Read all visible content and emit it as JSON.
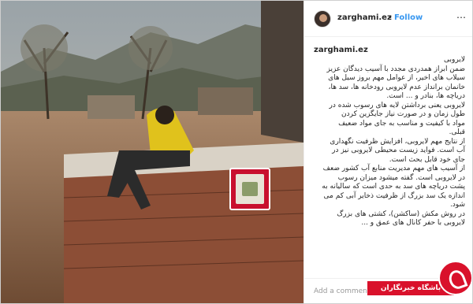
{
  "post": {
    "username": "zarghami.ez",
    "separator": "•",
    "follow_label": "Follow",
    "more_label": "⋯",
    "caption_user": "zarghami.ez",
    "caption_text": "لایروبی\nضمن ابراز همدردی مجدد با آسیب دیدگان عزیز\nسیلاب های اخیر، از عوامل مهم بروز سیل های\nخانمان برانداز عدم لایروبی رودخانه ها، سد ها،\nدریاچه ها، بنادر و ... است.\nلایروبی یعنی برداشتن لایه های رسوب شده در\nطول زمان و در صورت نیاز جایگزین کردن\nمواد با کیفیت و مناسب به جای مواد ضعیف\nقبلی.\nاز نتایج مهم لایروبی، افزایش ظرفیت نگهداری\nآب است. فواید زیست محیطی لایروبی نیز در\nجای خود قابل بحث است.\nاز آسیب های مهم مدیریت منابع آب کشور ضعف\nدر لایروبی است. گفته میشود میزان رسوب\nپشت دریاچه های سد به حدی است که سالیانه به\nاندازه یک سد بزرگ از ظرفیت ذخایر آبی کم می\nشود.\nدر روش مکش (ساکشن)، کشتی های بزرگ\nلایروبی با حفر کانال های عمق و ...",
    "comment_placeholder": "Add a comment..."
  },
  "watermark": {
    "logo_text": "باشگاه خبرنگاران",
    "brand_color": "#d9112b"
  },
  "colors": {
    "follow": "#3897f0",
    "text": "#262626",
    "border": "#efefef"
  }
}
